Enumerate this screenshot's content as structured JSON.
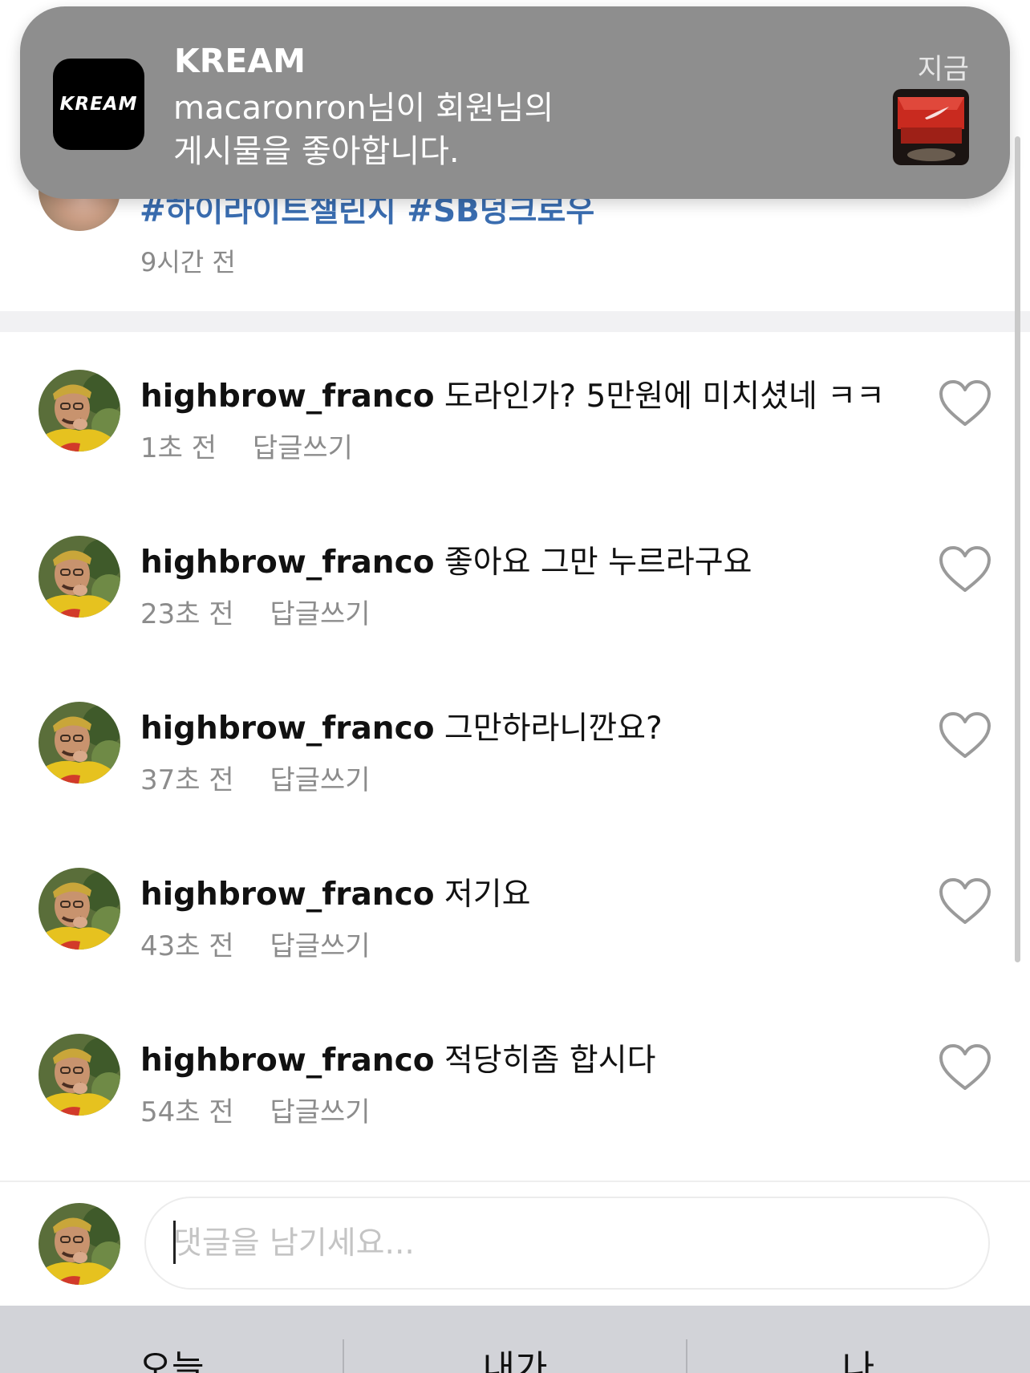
{
  "post": {
    "hashtags": "#하이라이트챌린지 #SB덩크로우",
    "time": "9시간 전"
  },
  "notification": {
    "app_icon_text": "KREAM",
    "app_name": "KREAM",
    "time": "지금",
    "message_line1": "macaronron님이 회원님의",
    "message_line2": "게시물을 좋아합니다.",
    "thumbnail_icon": "sneaker-box-thumbnail"
  },
  "comments": [
    {
      "username": "highbrow_franco",
      "text": "도라인가? 5만원에 미치셨네 ㅋㅋ",
      "time": "1초 전",
      "reply_label": "답글쓰기"
    },
    {
      "username": "highbrow_franco",
      "text": "좋아요 그만 누르라구요",
      "time": "23초 전",
      "reply_label": "답글쓰기"
    },
    {
      "username": "highbrow_franco",
      "text": "그만하라니깐요?",
      "time": "37초 전",
      "reply_label": "답글쓰기"
    },
    {
      "username": "highbrow_franco",
      "text": "저기요",
      "time": "43초 전",
      "reply_label": "답글쓰기"
    },
    {
      "username": "highbrow_franco",
      "text": "적당히좀 합시다",
      "time": "54초 전",
      "reply_label": "답글쓰기"
    }
  ],
  "comment_input": {
    "placeholder": "댓글을 남기세요..."
  },
  "suggestions": [
    "오늘",
    "내가",
    "나"
  ],
  "colors": {
    "hashtag": "#3a6db0",
    "notification_bg": "#8e8e8e",
    "meta_text": "#8c8c8c",
    "suggest_bar": "#d2d3d8"
  }
}
